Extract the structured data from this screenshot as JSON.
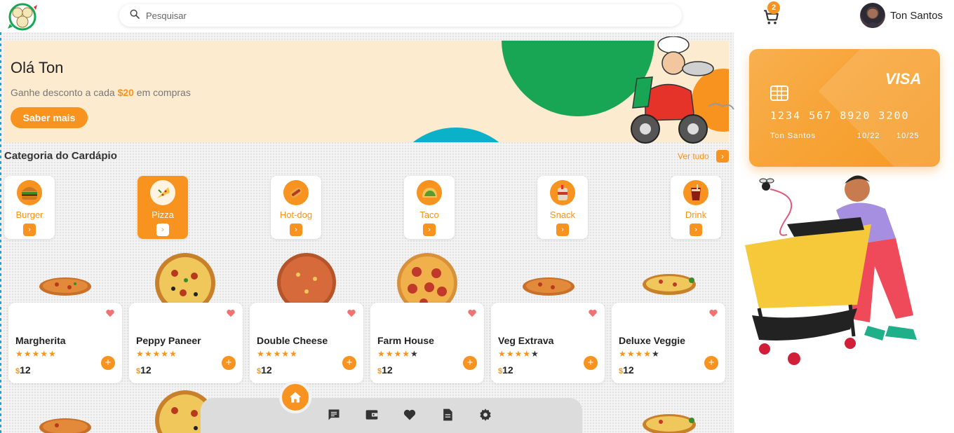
{
  "header": {
    "search_placeholder": "Pesquisar",
    "cart_count": "2",
    "user_name": "Ton Santos"
  },
  "banner": {
    "greeting": "Olá Ton",
    "promo_prefix": "Ganhe desconto a cada ",
    "promo_amount": "$20",
    "promo_suffix": " em compras",
    "button_label": "Saber mais"
  },
  "categories": {
    "title": "Categoria do Cardápio",
    "see_all": "Ver tudo",
    "items": [
      {
        "label": "Burger"
      },
      {
        "label": "Pizza",
        "active": true
      },
      {
        "label": "Hot-dog"
      },
      {
        "label": "Taco"
      },
      {
        "label": "Snack"
      },
      {
        "label": "Drink"
      }
    ]
  },
  "products": [
    {
      "name": "Margherita",
      "rating": 5,
      "currency": "$",
      "price": "12"
    },
    {
      "name": "Peppy Paneer",
      "rating": 5,
      "currency": "$",
      "price": "12"
    },
    {
      "name": "Double Cheese",
      "rating": 5,
      "currency": "$",
      "price": "12"
    },
    {
      "name": "Farm House",
      "rating": 4,
      "currency": "$",
      "price": "12"
    },
    {
      "name": "Veg Extrava",
      "rating": 4,
      "currency": "$",
      "price": "12"
    },
    {
      "name": "Deluxe Veggie",
      "rating": 4,
      "currency": "$",
      "price": "12"
    }
  ],
  "credit_card": {
    "brand": "VISA",
    "number": "1234 567 8920 3200",
    "holder": "Ton Santos",
    "date_from": "10/22",
    "date_to": "10/25"
  },
  "bottom_nav": [
    "home-icon",
    "chat-icon",
    "wallet-icon",
    "heart-icon",
    "receipt-icon",
    "settings-icon"
  ],
  "colors": {
    "accent": "#f7931e",
    "banner_bg": "#fdebd0",
    "green": "#19a654",
    "blue": "#0bb0c9"
  }
}
